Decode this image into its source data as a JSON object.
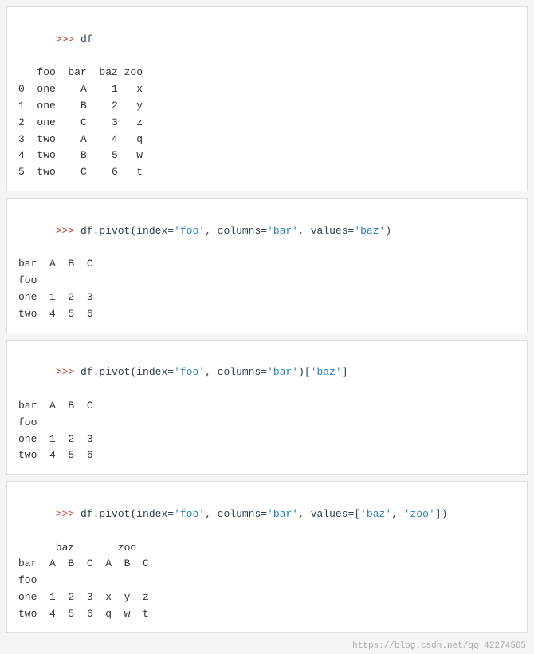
{
  "panel1": {
    "prompt": ">>> ",
    "command": "df",
    "table_header": "   foo  bar  baz zoo",
    "rows": [
      "0  one    A    1   x",
      "1  one    B    2   y",
      "2  one    C    3   z",
      "3  two    A    4   q",
      "4  two    B    5   w",
      "5  two    C    6   t"
    ]
  },
  "panel2": {
    "prompt": ">>> ",
    "command_prefix": "df.pivot(index=",
    "command_index": "'foo'",
    "command_mid1": ", columns=",
    "command_col": "'bar'",
    "command_mid2": ", values=",
    "command_val": "'baz'",
    "command_suffix": ")",
    "output_line1": "bar  A  B  C",
    "output_line2": "foo",
    "output_line3": "one  1  2  3",
    "output_line4": "two  4  5  6"
  },
  "panel3": {
    "prompt": ">>> ",
    "command_prefix": "df.pivot(index=",
    "command_index": "'foo'",
    "command_mid1": ", columns=",
    "command_col": "'bar'",
    "command_suffix": ")[",
    "command_key": "'baz'",
    "command_end": "]",
    "output_line1": "bar  A  B  C",
    "output_line2": "foo",
    "output_line3": "one  1  2  3",
    "output_line4": "two  4  5  6"
  },
  "panel4": {
    "prompt": ">>> ",
    "command_prefix": "df.pivot(index=",
    "command_index": "'foo'",
    "command_mid1": ", columns=",
    "command_col": "'bar'",
    "command_mid2": ", values=[",
    "command_val1": "'baz'",
    "command_comma": ", ",
    "command_val2": "'zoo'",
    "command_suffix": "])",
    "output_line1": "      baz       zoo",
    "output_line2": "bar  A  B  C  A  B  C",
    "output_line3": "foo",
    "output_line4": "one  1  2  3  x  y  z",
    "output_line5": "two  4  5  6  q  w  t"
  },
  "footer": {
    "text": "https://blog.csdn.net/qq_42274565"
  }
}
